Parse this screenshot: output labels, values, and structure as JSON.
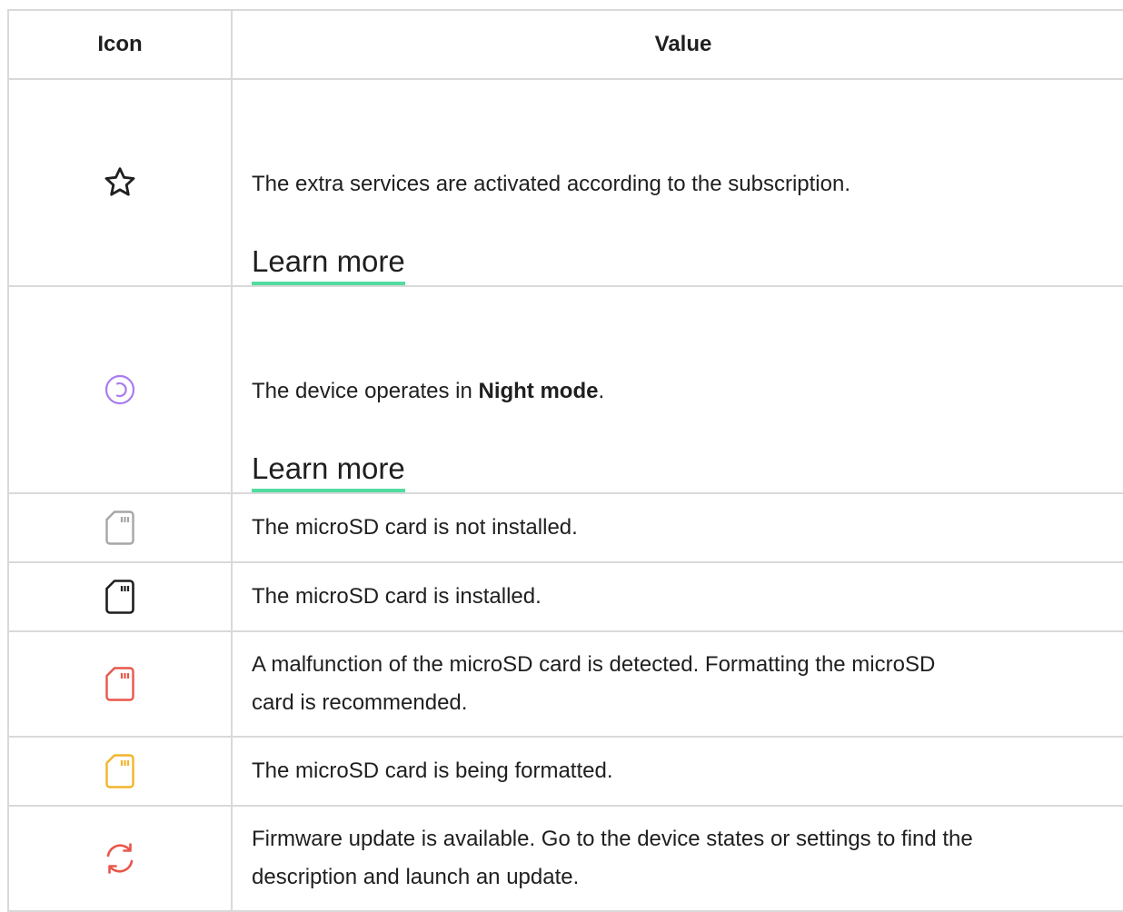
{
  "table": {
    "headers": {
      "icon": "Icon",
      "value": "Value"
    },
    "rows": [
      {
        "icon": "star-outline-icon",
        "icon_color": "#1f1f1f",
        "text": "The extra services are activated according to the subscription.",
        "link": "Learn more"
      },
      {
        "icon": "night-mode-icon",
        "icon_color": "#a87cf0",
        "text_before": "The device operates in ",
        "text_bold": "Night mode",
        "text_after": ".",
        "link": "Learn more"
      },
      {
        "icon": "microsd-card-gray-icon",
        "icon_color": "#a6a6a6",
        "text": "The microSD card is not installed."
      },
      {
        "icon": "microsd-card-black-icon",
        "icon_color": "#1f1f1f",
        "text": "The microSD card is installed."
      },
      {
        "icon": "microsd-card-red-icon",
        "icon_color": "#e8574a",
        "text_line1": "A malfunction of the microSD card is detected. Formatting the microSD",
        "text_line2": "card is recommended."
      },
      {
        "icon": "microsd-card-yellow-icon",
        "icon_color": "#f2b52c",
        "text": "The microSD card is being formatted."
      },
      {
        "icon": "firmware-update-icon",
        "icon_color": "#e8574a",
        "text_line1": "Firmware update is available. Go to the device states or settings to find the",
        "text_line2": "description and launch an update."
      }
    ]
  },
  "colors": {
    "link_underline": "#52dca0",
    "border": "#d9d9d9",
    "text": "#1f1f1f"
  }
}
